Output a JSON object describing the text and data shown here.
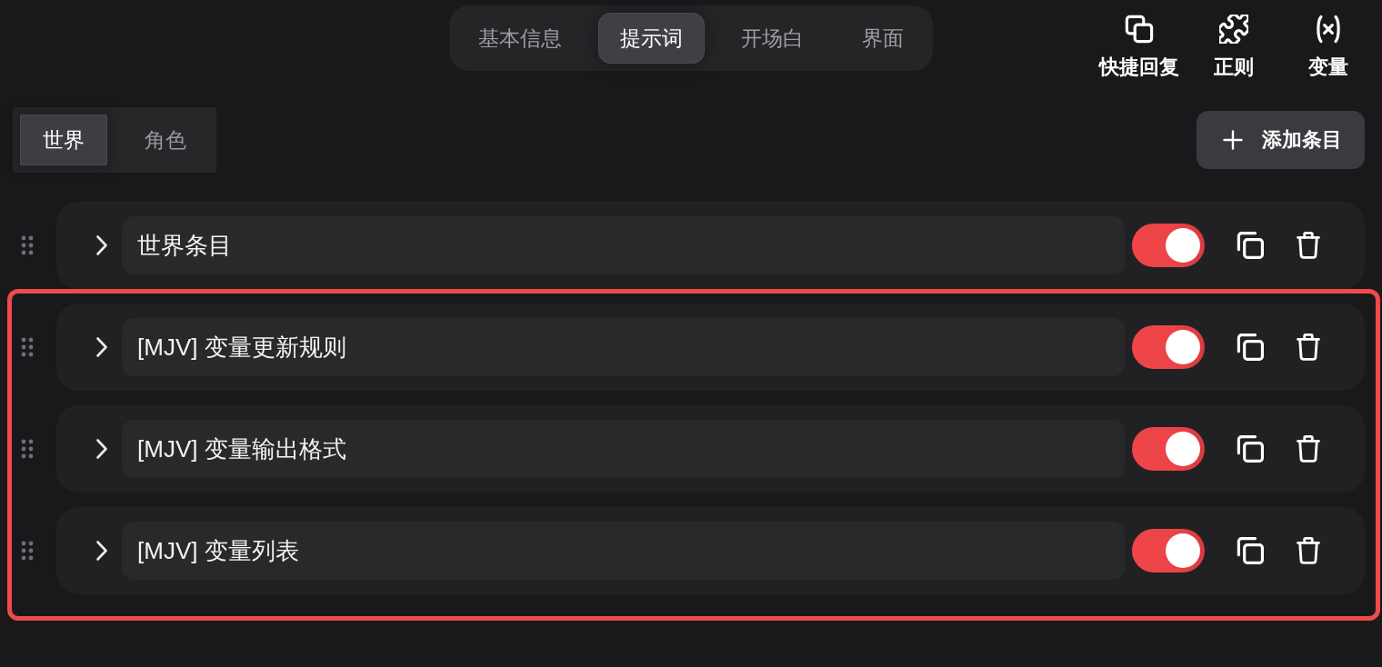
{
  "tabs": [
    {
      "label": "基本信息",
      "selected": false
    },
    {
      "label": "提示词",
      "selected": true
    },
    {
      "label": "开场白",
      "selected": false
    },
    {
      "label": "界面",
      "selected": false
    }
  ],
  "actions": [
    {
      "kind": "squares",
      "label": "快捷回复"
    },
    {
      "kind": "puzzle",
      "label": "正则"
    },
    {
      "kind": "variable",
      "label": "变量"
    }
  ],
  "scope_tabs": [
    {
      "label": "世界",
      "selected": true
    },
    {
      "label": "角色",
      "selected": false
    }
  ],
  "add_button": {
    "label": "添加条目"
  },
  "entries": [
    {
      "name": "世界条目",
      "expanded": false,
      "enabled": true,
      "highlighted": false
    },
    {
      "name": "[MJV] 变量更新规则",
      "expanded": false,
      "enabled": true,
      "highlighted": true
    },
    {
      "name": "[MJV] 变量输出格式",
      "expanded": false,
      "enabled": true,
      "highlighted": true
    },
    {
      "name": "[MJV] 变量列表",
      "expanded": false,
      "enabled": true,
      "highlighted": true
    }
  ]
}
